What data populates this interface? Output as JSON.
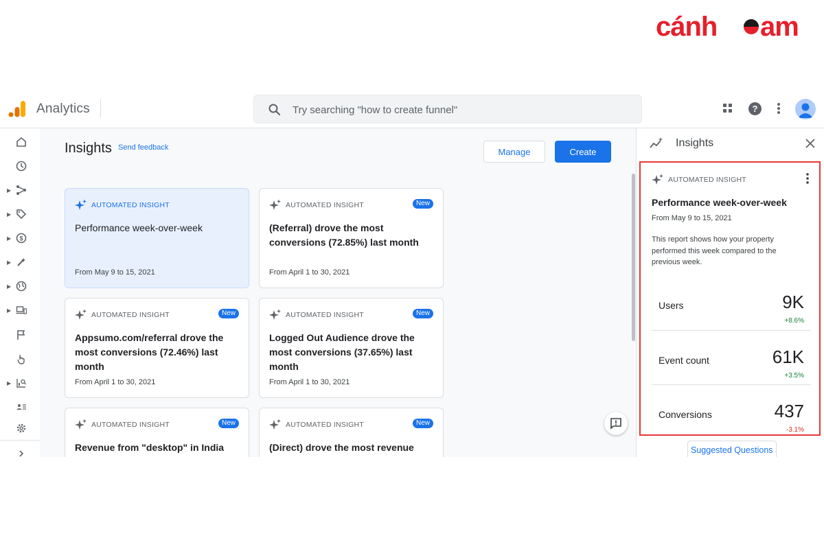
{
  "brand": {
    "logo_text": "cánheam"
  },
  "topbar": {
    "app_name": "Analytics",
    "search_placeholder": "Try searching \"how to create funnel\""
  },
  "page": {
    "title": "Insights",
    "send_feedback": "Send feedback",
    "manage_label": "Manage",
    "create_label": "Create"
  },
  "cards": [
    {
      "kicker": "AUTOMATED INSIGHT",
      "badge": "",
      "title": "Performance week-over-week",
      "date": "From May 9 to 15, 2021"
    },
    {
      "kicker": "AUTOMATED INSIGHT",
      "badge": "New",
      "title": "(Referral) drove the most conversions (72.85%) last month",
      "date": "From April 1 to 30, 2021"
    },
    {
      "kicker": "AUTOMATED INSIGHT",
      "badge": "New",
      "title": "Appsumo.com/referral drove the most conversions (72.46%) last month",
      "date": "From April 1 to 30, 2021"
    },
    {
      "kicker": "AUTOMATED INSIGHT",
      "badge": "New",
      "title": "Logged Out Audience drove the most conversions (37.65%) last month",
      "date": "From April 1 to 30, 2021"
    },
    {
      "kicker": "AUTOMATED INSIGHT",
      "badge": "New",
      "title": "Revenue from \"desktop\" in India",
      "date": ""
    },
    {
      "kicker": "AUTOMATED INSIGHT",
      "badge": "New",
      "title": "(Direct) drove the most revenue",
      "date": ""
    }
  ],
  "panel": {
    "title": "Insights",
    "kicker": "AUTOMATED INSIGHT",
    "insight_title": "Performance week-over-week",
    "insight_date": "From May 9 to 15, 2021",
    "description": "This report shows how your property performed this week compared to the previous week.",
    "metrics": [
      {
        "name": "Users",
        "value": "9K",
        "delta": "+8.6%"
      },
      {
        "name": "Event count",
        "value": "61K",
        "delta": "+3.5%"
      },
      {
        "name": "Conversions",
        "value": "437",
        "delta": "-3.1%"
      }
    ],
    "suggested_label": "Suggested Questions"
  },
  "icons": {
    "rail": [
      "home-icon",
      "clock-icon",
      "explore-icon",
      "tag-icon",
      "dollar-icon",
      "magic-icon",
      "globe-icon",
      "devices-icon",
      "flag-icon",
      "touch-icon",
      "report-search-icon",
      "audience-icon",
      "settings-icon",
      "chevron-right-icon"
    ]
  },
  "colors": {
    "accent": "#1a73e8",
    "highlight_border": "#e53935",
    "positive": "#188038",
    "negative": "#d93025",
    "selected_card": "#e8f0fe"
  }
}
